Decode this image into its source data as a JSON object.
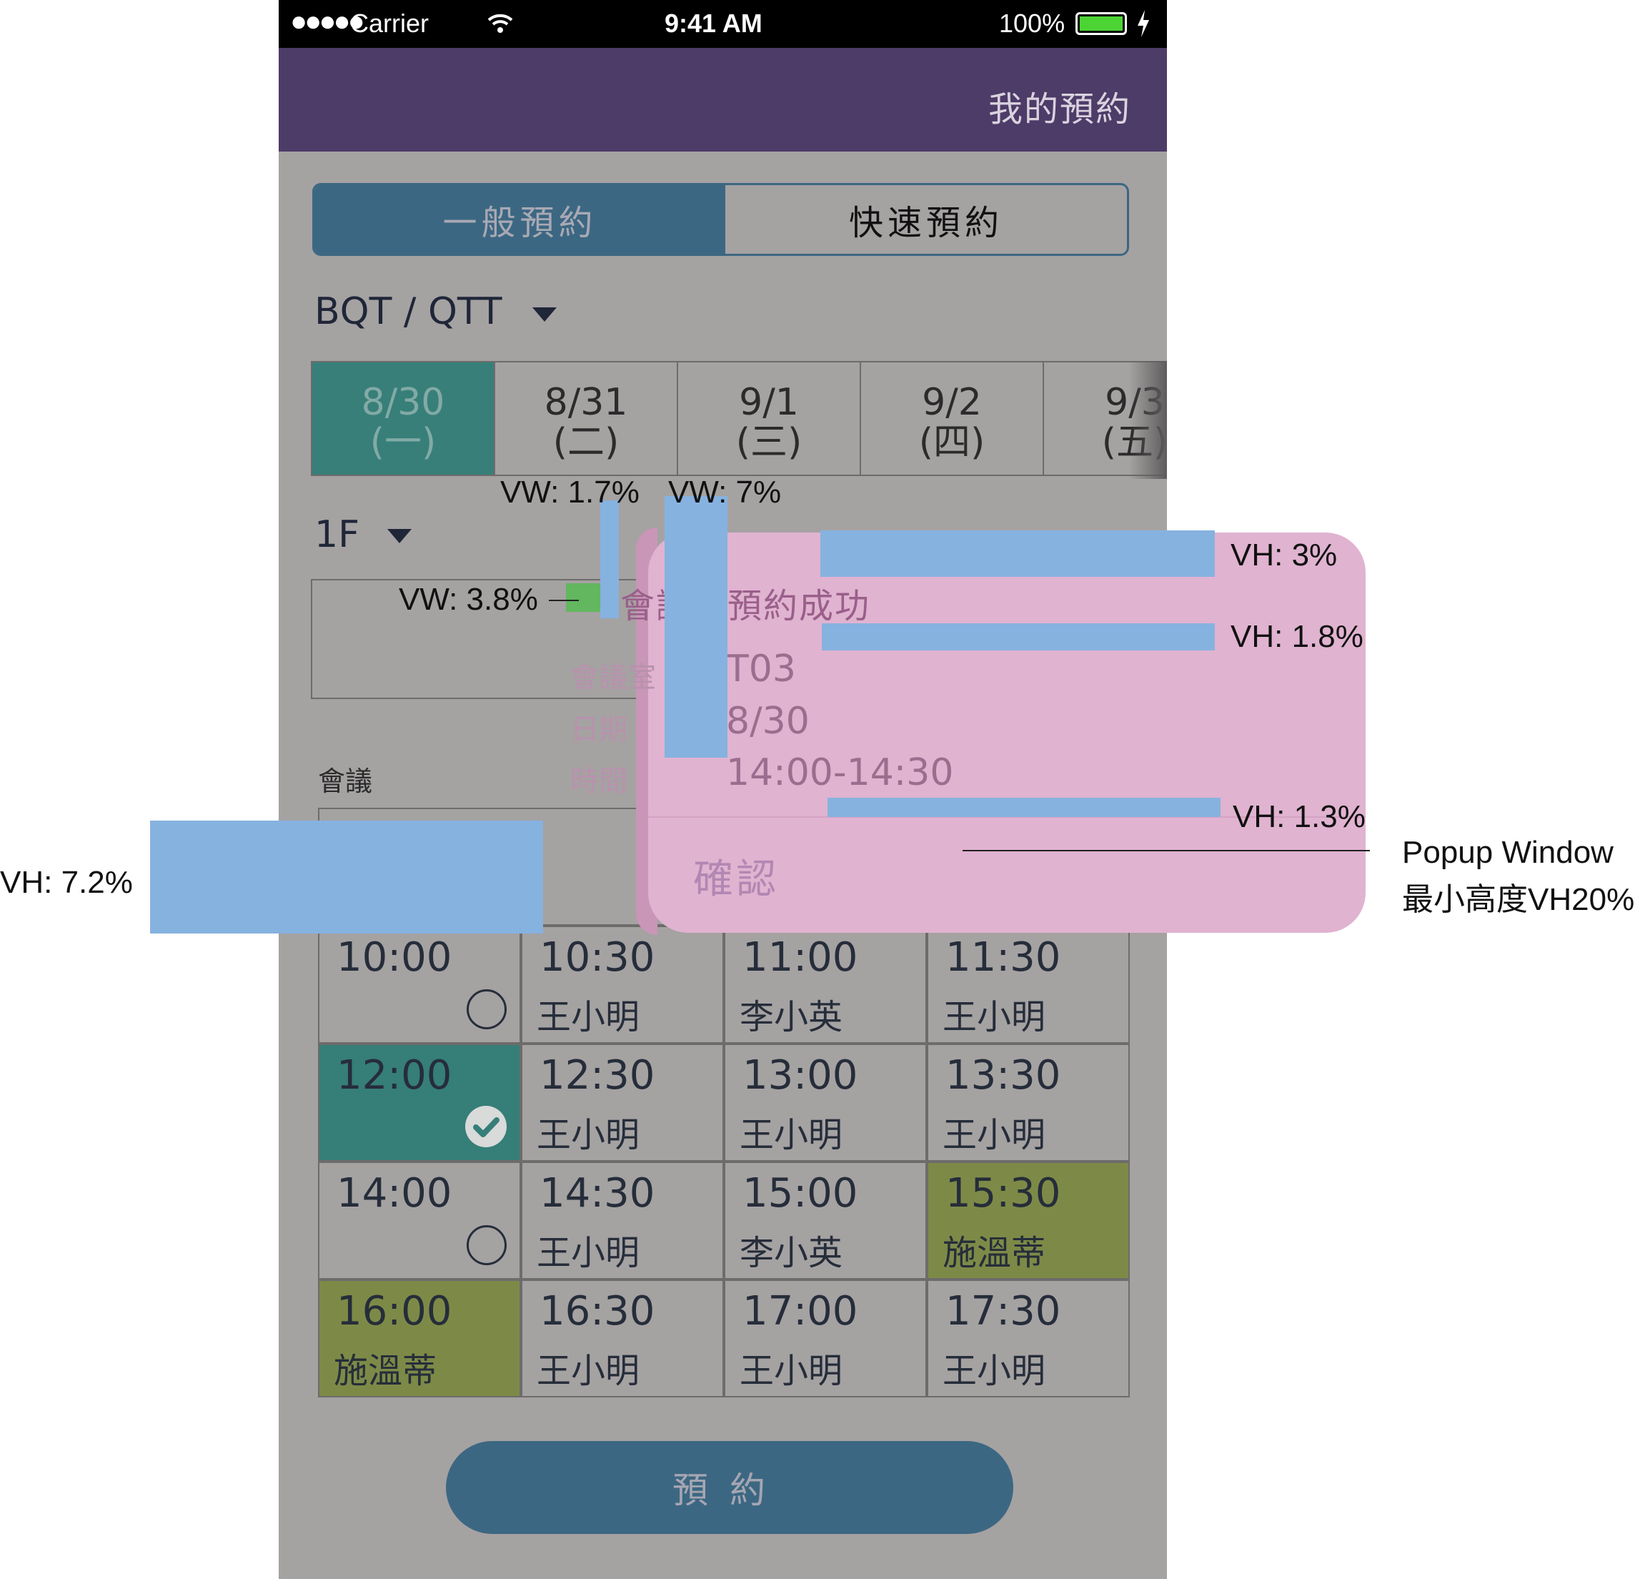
{
  "status_bar": {
    "signal": "●●●●●",
    "carrier": "Carrier",
    "time": "9:41 AM",
    "battery": "100%"
  },
  "nav": {
    "title": "我的預約"
  },
  "segment": {
    "general": "一般預約",
    "quick": "快速預約"
  },
  "location": {
    "value": "BQT / QTT"
  },
  "dates": [
    {
      "date": "8/30",
      "weekday": "(一)"
    },
    {
      "date": "8/31",
      "weekday": "(二)"
    },
    {
      "date": "9/1",
      "weekday": "(三)"
    },
    {
      "date": "9/2",
      "weekday": "(四)"
    },
    {
      "date": "9/3",
      "weekday": "(五)"
    }
  ],
  "floor": {
    "value": "1F"
  },
  "rooms": {
    "partial": "T0"
  },
  "table_headers": {
    "meeting": "會議",
    "booking": "預約"
  },
  "slots": [
    {
      "time": "10:00",
      "name": "",
      "state": "available"
    },
    {
      "time": "10:30",
      "name": "王小明",
      "state": "booked"
    },
    {
      "time": "11:00",
      "name": "李小英",
      "state": "booked"
    },
    {
      "time": "11:30",
      "name": "王小明",
      "state": "booked"
    },
    {
      "time": "12:00",
      "name": "",
      "state": "selected"
    },
    {
      "time": "12:30",
      "name": "王小明",
      "state": "booked"
    },
    {
      "time": "13:00",
      "name": "王小明",
      "state": "booked"
    },
    {
      "time": "13:30",
      "name": "王小明",
      "state": "booked"
    },
    {
      "time": "14:00",
      "name": "",
      "state": "available"
    },
    {
      "time": "14:30",
      "name": "王小明",
      "state": "booked"
    },
    {
      "time": "15:00",
      "name": "李小英",
      "state": "booked"
    },
    {
      "time": "15:30",
      "name": "施溫蒂",
      "state": "mine"
    },
    {
      "time": "16:00",
      "name": "施溫蒂",
      "state": "mine"
    },
    {
      "time": "16:30",
      "name": "王小明",
      "state": "booked"
    },
    {
      "time": "17:00",
      "name": "王小明",
      "state": "booked"
    },
    {
      "time": "17:30",
      "name": "王小明",
      "state": "booked"
    }
  ],
  "book_button": {
    "label": "預約"
  },
  "popup": {
    "title": "會議室預約成功",
    "room_label": "會議室",
    "room_value": "T03",
    "date_label": "日期",
    "date_value": "8/30",
    "time_label": "時間",
    "time_value": "14:00-14:30",
    "confirm": "確認"
  },
  "annotations": {
    "vw1": "VW: 1.7%",
    "vw2": "VW: 7%",
    "vw3": "VW: 3.8%",
    "vh1": "VH: 3%",
    "vh2": "VH: 1.8%",
    "vh3": "VH: 1.3%",
    "vh4": "VH: 7.2%",
    "popup_label_1": "Popup Window",
    "popup_label_2": "最小高度VH20%"
  },
  "colors": {
    "nav": "#4d3b68",
    "accent": "#3c6782",
    "selected": "#367e78",
    "mine": "#7d8a47",
    "popup": "#e0b3d0",
    "annotation": "#86b2e0"
  }
}
